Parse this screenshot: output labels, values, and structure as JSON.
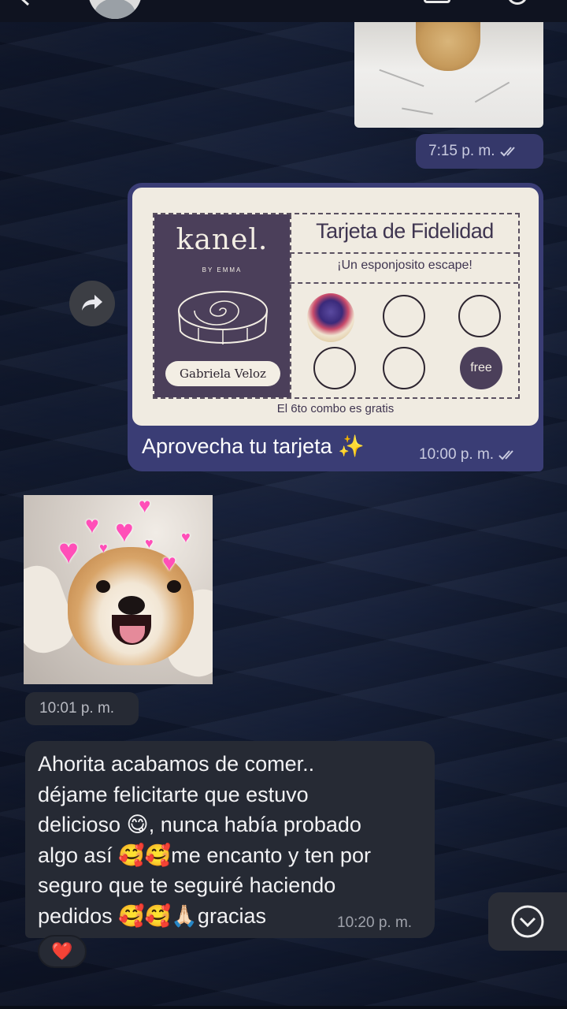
{
  "messages": {
    "image_top": {
      "time": "7:15 p. m."
    },
    "card_message": {
      "card": {
        "brand": "kanel.",
        "brand_sub": "BY EMMA",
        "title": "Tarjeta de Fidelidad",
        "subtitle": "¡Un esponjosito escape!",
        "customer_name": "Gabriela Veloz",
        "stamps_filled": 1,
        "stamps_total": 6,
        "free_label": "free",
        "footer": "El 6to combo es gratis"
      },
      "caption": "Aprovecha tu tarjeta ✨",
      "time": "10:00 p. m."
    },
    "sticker": {
      "time": "10:01 p. m."
    },
    "incoming_text": {
      "lines": [
        "Ahorita acabamos de comer..",
        "déjame felicitarte que estuvo",
        "delicioso 😋, nunca había probado",
        "algo así 🥰🥰me encanto y ten por",
        "seguro que te seguiré haciendo",
        "pedidos 🥰🥰🙏🏻gracias"
      ],
      "time": "10:20 p. m.",
      "reaction": "❤️"
    }
  },
  "icons": {
    "forward": "forward-arrow-icon",
    "scroll_down": "chevron-down-icon",
    "read_status": "double-check-icon"
  },
  "colors": {
    "outgoing_bubble": "#3a3d75",
    "incoming_bubble": "#262a34",
    "card_bg": "#f0ebe1",
    "card_accent": "#4b3f5a",
    "read_ticks": "#c9cbe0"
  }
}
